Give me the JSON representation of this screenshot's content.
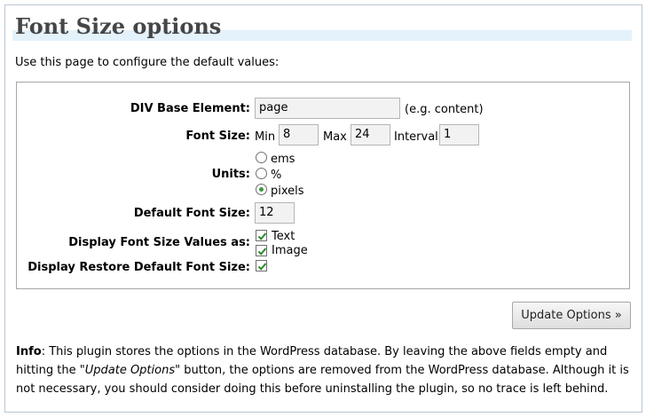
{
  "page": {
    "title": "Font Size options",
    "intro": "Use this page to configure the default values:"
  },
  "form": {
    "div_base": {
      "label": "DIV Base Element:",
      "value": "page",
      "hint": "(e.g. content)"
    },
    "font_size": {
      "label": "Font Size:",
      "min_label": "Min",
      "min_value": "8",
      "max_label": "Max",
      "max_value": "24",
      "interval_label": "Interval",
      "interval_value": "1"
    },
    "units": {
      "label": "Units:",
      "options": [
        "ems",
        "%",
        "pixels"
      ],
      "selected": "pixels"
    },
    "default_font_size": {
      "label": "Default Font Size:",
      "value": "12"
    },
    "display_values": {
      "label": "Display Font Size Values as:",
      "options": [
        {
          "label": "Text",
          "checked": true
        },
        {
          "label": "Image",
          "checked": true
        }
      ]
    },
    "display_restore": {
      "label": "Display Restore Default Font Size:",
      "checked": true
    }
  },
  "button": {
    "label": "Update Options »"
  },
  "info": {
    "prefix": "Info",
    "part1": ": This plugin stores the options in the WordPress database. By leaving the above fields empty and hitting the \"",
    "emphasis": "Update Options",
    "part2": "\" button, the options are removed from the WordPress database. Although it is not necessary, you should consider doing this before uninstalling the plugin, so no trace is left behind."
  },
  "colors": {
    "title_band": "#e4f2fc",
    "title_text": "#464646",
    "radio_dot": "#3a9a3a",
    "check_mark": "#2a8a2a"
  }
}
